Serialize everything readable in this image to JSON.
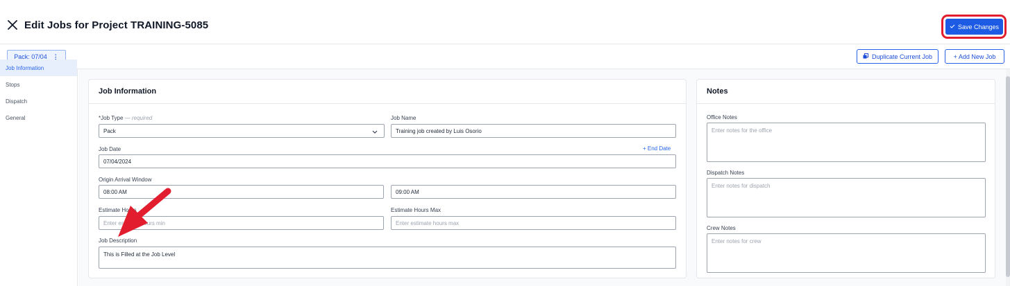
{
  "header": {
    "title": "Edit Jobs for Project TRAINING-5085",
    "save_label": "Save Changes"
  },
  "toolbar": {
    "pack_tab_label": "Pack: 07/04",
    "duplicate_label": "Duplicate Current Job",
    "add_label": "+ Add New Job"
  },
  "sidebar": {
    "items": [
      {
        "label": "Job Information"
      },
      {
        "label": "Stops"
      },
      {
        "label": "Dispatch"
      },
      {
        "label": "General"
      }
    ]
  },
  "job_info": {
    "title": "Job Information",
    "job_type_label": "*Job Type",
    "job_type_hint": " — required",
    "job_type_value": "Pack",
    "job_name_label": "Job Name",
    "job_name_value": "Training job created by Luis Osorio",
    "job_date_label": "Job Date",
    "end_date_link": "+ End Date",
    "job_date_value": "07/04/2024",
    "arrival_window_label": "Origin Arrival Window",
    "arrival_start": "08:00 AM",
    "arrival_end": "09:00 AM",
    "est_min_label": "Estimate Hours",
    "est_min_placeholder": "Enter estimate hours min",
    "est_max_label": "Estimate Hours Max",
    "est_max_placeholder": "Enter estimate hours max",
    "desc_label": "Job Description",
    "desc_value": "This is Filled at the Job Level"
  },
  "notes": {
    "title": "Notes",
    "office_label": "Office Notes",
    "office_placeholder": "Enter notes for the office",
    "dispatch_label": "Dispatch Notes",
    "dispatch_placeholder": "Enter notes for dispatch",
    "crew_label": "Crew Notes",
    "crew_placeholder": "Enter notes for crew"
  },
  "colors": {
    "primary": "#1d5be4",
    "highlight": "#e11d2e",
    "arrow": "#e11d2e"
  }
}
